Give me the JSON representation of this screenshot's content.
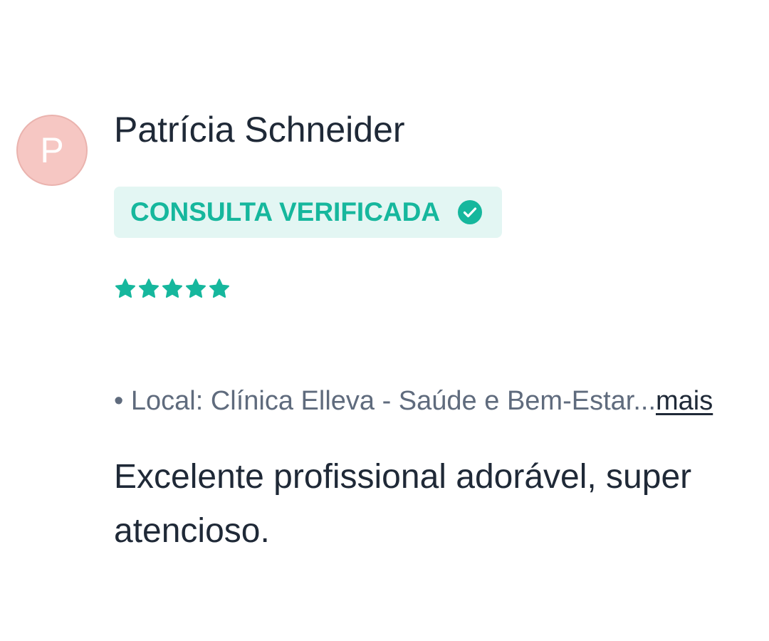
{
  "review": {
    "author_initial": "P",
    "author_name": "Patrícia Schneider",
    "badge": {
      "label": "CONSULTA VERIFICADA",
      "icon": "check-circle-icon"
    },
    "rating": {
      "stars": 5,
      "max": 5,
      "icon": "star-icon"
    },
    "location": {
      "bullet": "•",
      "text": "Local: Clínica Elleva - Saúde e Bem-Estar...",
      "more_label": "mais"
    },
    "body": "Excelente profissional adorável, super atencioso."
  },
  "colors": {
    "accent": "#16b79d",
    "badge_background": "#e3f6f3",
    "avatar_background": "#f6c7c3",
    "text_primary": "#1f2937",
    "text_secondary": "#5f6b7d"
  }
}
